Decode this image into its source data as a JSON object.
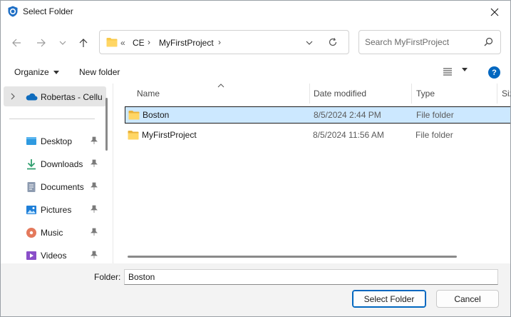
{
  "window": {
    "title": "Select Folder"
  },
  "address": {
    "breadcrumbs": [
      "CE",
      "MyFirstProject"
    ],
    "overflow": "«"
  },
  "search": {
    "placeholder": "Search MyFirstProject"
  },
  "commands": {
    "organize": "Organize",
    "new_folder": "New folder",
    "help": "?"
  },
  "nav": {
    "onedrive": "Robertas - Cellu",
    "items": [
      {
        "label": "Desktop",
        "icon": "desktop-icon"
      },
      {
        "label": "Downloads",
        "icon": "downloads-icon"
      },
      {
        "label": "Documents",
        "icon": "documents-icon"
      },
      {
        "label": "Pictures",
        "icon": "pictures-icon"
      },
      {
        "label": "Music",
        "icon": "music-icon"
      },
      {
        "label": "Videos",
        "icon": "videos-icon"
      }
    ]
  },
  "columns": {
    "name": "Name",
    "date": "Date modified",
    "type": "Type",
    "size": "Siz"
  },
  "rows": [
    {
      "name": "Boston",
      "date": "8/5/2024 2:44 PM",
      "type": "File folder",
      "selected": true
    },
    {
      "name": "MyFirstProject",
      "date": "8/5/2024 11:56 AM",
      "type": "File folder",
      "selected": false
    }
  ],
  "footer": {
    "folder_label": "Folder:",
    "folder_value": "Boston",
    "select_label": "Select Folder",
    "cancel_label": "Cancel"
  },
  "colors": {
    "accent": "#0067c0",
    "selection": "#cce8ff",
    "folder": "#f8c94a"
  }
}
